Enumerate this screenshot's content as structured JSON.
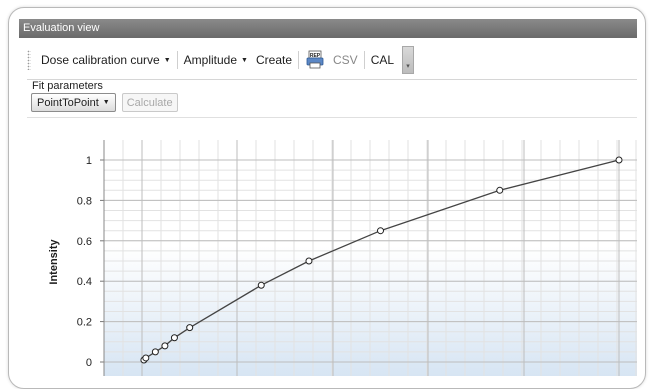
{
  "window": {
    "title": "Evaluation view"
  },
  "toolbar": {
    "curve_dropdown": "Dose calibration curve",
    "amplitude_dropdown": "Amplitude",
    "create_label": "Create",
    "printer_icon": "rep-printer-icon",
    "csv_label": "CSV",
    "cal_label": "CAL"
  },
  "fit": {
    "section_label": "Fit parameters",
    "method_value": "PointToPoint",
    "calculate_label": "Calculate"
  },
  "colors": {
    "titlebar": "#767676",
    "grid": "#c8c8c8",
    "curve": "#444444",
    "plot_gradient_end": "#d7e5f3"
  },
  "chart_data": {
    "type": "line",
    "title": "",
    "xlabel": "",
    "ylabel": "Intensity",
    "ylim": [
      0,
      1
    ],
    "yticks": [
      "0",
      "0.2",
      "0.4",
      "0.6",
      "0.8",
      "1"
    ],
    "grid": true,
    "series": [
      {
        "x": [
          0.02,
          0.04,
          0.14,
          0.24,
          0.34,
          0.5,
          1.25,
          1.75,
          2.5,
          3.75,
          5.0
        ],
        "y": [
          0.01,
          0.02,
          0.05,
          0.08,
          0.12,
          0.17,
          0.38,
          0.5,
          0.65,
          0.85,
          1.0
        ]
      }
    ]
  }
}
